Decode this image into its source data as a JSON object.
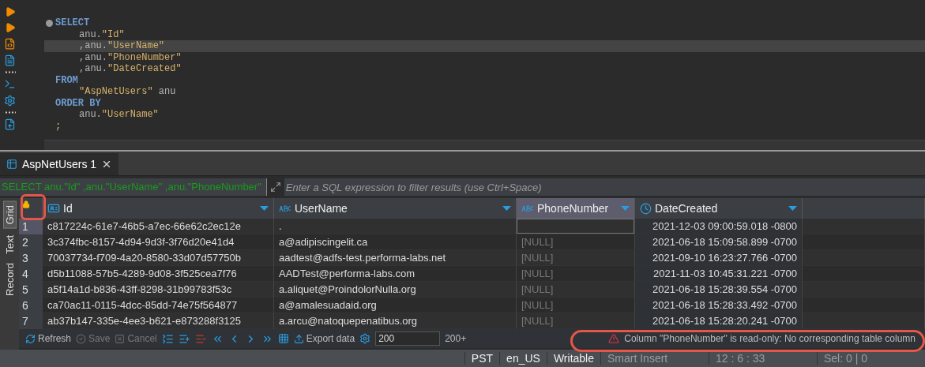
{
  "editor": {
    "lines": [
      {
        "highlighted": false,
        "fold": true,
        "kind": "clause",
        "tokens": [
          {
            "kind": "keyword",
            "text": "SELECT"
          }
        ]
      },
      {
        "highlighted": false,
        "fold": false,
        "kind": "item",
        "tokens": [
          {
            "kind": "plain",
            "text": "anu."
          },
          {
            "kind": "string",
            "text": "\"Id\""
          }
        ]
      },
      {
        "highlighted": true,
        "fold": false,
        "kind": "item",
        "tokens": [
          {
            "kind": "plain",
            "text": ",anu."
          },
          {
            "kind": "string",
            "text": "\"UserName\""
          }
        ]
      },
      {
        "highlighted": false,
        "fold": false,
        "kind": "item",
        "tokens": [
          {
            "kind": "plain",
            "text": ",anu."
          },
          {
            "kind": "string",
            "text": "\"PhoneNumber\""
          }
        ]
      },
      {
        "highlighted": false,
        "fold": false,
        "kind": "item",
        "tokens": [
          {
            "kind": "plain",
            "text": ",anu."
          },
          {
            "kind": "string",
            "text": "\"DateCreated\""
          }
        ]
      },
      {
        "highlighted": false,
        "fold": false,
        "kind": "clause",
        "tokens": [
          {
            "kind": "keyword",
            "text": "FROM"
          }
        ]
      },
      {
        "highlighted": false,
        "fold": false,
        "kind": "item",
        "tokens": [
          {
            "kind": "string",
            "text": "\"AspNetUsers\""
          },
          {
            "kind": "plain",
            "text": " anu"
          }
        ]
      },
      {
        "highlighted": false,
        "fold": false,
        "kind": "clause",
        "tokens": [
          {
            "kind": "keyword",
            "text": "ORDER BY"
          }
        ]
      },
      {
        "highlighted": false,
        "fold": false,
        "kind": "item",
        "tokens": [
          {
            "kind": "plain",
            "text": "anu."
          },
          {
            "kind": "string",
            "text": "\"UserName\""
          }
        ]
      },
      {
        "highlighted": false,
        "fold": false,
        "kind": "clause",
        "tokens": [
          {
            "kind": "string",
            "text": ";"
          }
        ]
      }
    ]
  },
  "result_tabs": [
    {
      "label": "AspNetUsers 1",
      "selected": true
    }
  ],
  "filter": {
    "query": "SELECT anu.\"Id\" ,anu.\"UserName\" ,anu.\"PhoneNumber\"",
    "placeholder": "Enter a SQL expression to filter results (use Ctrl+Space)"
  },
  "view_tabs": [
    {
      "label": "Grid",
      "selected": true
    },
    {
      "label": "Text",
      "selected": false
    },
    {
      "label": "Record",
      "selected": false
    }
  ],
  "table": {
    "columns": [
      {
        "label": "Id",
        "kind": "key",
        "selected": false
      },
      {
        "label": "UserName",
        "kind": "text",
        "selected": false
      },
      {
        "label": "PhoneNumber",
        "kind": "text",
        "selected": true
      },
      {
        "label": "DateCreated",
        "kind": "date",
        "selected": false
      }
    ],
    "rows": [
      {
        "num": "1",
        "selected": true,
        "cells": [
          {
            "text": "c817224c-61e7-46b5-a7ec-66e62c2ec12e",
            "null": false
          },
          {
            "text": ".",
            "null": false
          },
          {
            "null": false,
            "editing": true
          },
          {
            "text": "2021-12-03 09:00:59.018 -0800",
            "null": false
          }
        ]
      },
      {
        "num": "2",
        "selected": false,
        "cells": [
          {
            "text": "3c374fbc-8157-4d94-9d3f-3f76d20e41d4",
            "null": false
          },
          {
            "text": "a@adipiscingelit.ca",
            "null": false
          },
          {
            "text": "[NULL]",
            "null": true
          },
          {
            "text": "2021-06-18 15:09:58.899 -0700",
            "null": false
          }
        ]
      },
      {
        "num": "3",
        "selected": false,
        "cells": [
          {
            "text": "70037734-f709-4a20-8580-33d07d57750b",
            "null": false
          },
          {
            "text": "aadtest@adfs-test.performa-labs.net",
            "null": false
          },
          {
            "text": "[NULL]",
            "null": true
          },
          {
            "text": "2021-09-10 16:23:27.766 -0700",
            "null": false
          }
        ]
      },
      {
        "num": "4",
        "selected": false,
        "cells": [
          {
            "text": "d5b11088-57b5-4289-9d08-3f525cea7f76",
            "null": false
          },
          {
            "text": "AADTest@performa-labs.com",
            "null": false
          },
          {
            "text": "[NULL]",
            "null": true
          },
          {
            "text": "2021-11-03 10:45:31.221 -0700",
            "null": false
          }
        ]
      },
      {
        "num": "5",
        "selected": false,
        "cells": [
          {
            "text": "a5f14a1d-b836-43ff-8298-31b99783f53c",
            "null": false
          },
          {
            "text": "a.aliquet@ProindolorNulla.org",
            "null": false
          },
          {
            "text": "[NULL]",
            "null": true
          },
          {
            "text": "2021-06-18 15:28:39.554 -0700",
            "null": false
          }
        ]
      },
      {
        "num": "6",
        "selected": false,
        "cells": [
          {
            "text": "ca70ac11-0115-4dcc-85dd-74e75f564877",
            "null": false
          },
          {
            "text": "a@amalesuadaid.org",
            "null": false
          },
          {
            "text": "[NULL]",
            "null": true
          },
          {
            "text": "2021-06-18 15:28:33.492 -0700",
            "null": false
          }
        ]
      },
      {
        "num": "7",
        "selected": false,
        "cells": [
          {
            "text": "ab37b147-335e-4ee3-b621-e873288f3125",
            "null": false
          },
          {
            "text": "a.arcu@natoquepenatibus.org",
            "null": false
          },
          {
            "text": "[NULL]",
            "null": true
          },
          {
            "text": "2021-06-18 15:28:20.241 -0700",
            "null": false
          }
        ]
      }
    ]
  },
  "toolbar": {
    "buttons": [
      {
        "label": "Refresh",
        "disabled": false
      },
      {
        "label": "Save",
        "disabled": true
      },
      {
        "label": "Cancel",
        "disabled": true
      }
    ],
    "export_label": "Export data",
    "fetch_size": "200",
    "fetch_all": "200+",
    "message": "Column \"PhoneNumber\" is read-only: No corresponding table column"
  },
  "status_bar": [
    "PST",
    "en_US",
    "Writable",
    "Smart Insert",
    "12 : 6 : 33",
    "Sel: 0 | 0"
  ]
}
